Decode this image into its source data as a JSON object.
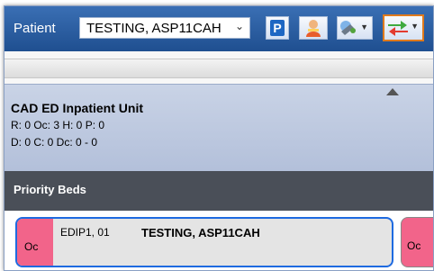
{
  "toolbar": {
    "patient_label": "Patient",
    "patient_value": "TESTING, ASP11CAH",
    "p_button_label": "P"
  },
  "unit": {
    "title": "CAD ED Inpatient Unit",
    "stats_line1": "R: 0 Oc: 3 H: 0 P: 0",
    "stats_line2": "D: 0 C: 0 Dc: 0 - 0"
  },
  "priority": {
    "title": "Priority Beds"
  },
  "beds": [
    {
      "status": "Oc",
      "location": "EDIP1, 01",
      "patient": "TESTING, ASP11CAH"
    },
    {
      "status": "Oc"
    }
  ],
  "colors": {
    "toolbar_blue": "#2a5ea3",
    "occupied_pink": "#f2648a",
    "selected_border": "#1e6ae0",
    "highlight_orange": "#e07a1c"
  },
  "icons": [
    "chevron-down-icon",
    "person-icon",
    "action-icon",
    "swap-arrows-icon",
    "collapse-arrow-icon"
  ]
}
